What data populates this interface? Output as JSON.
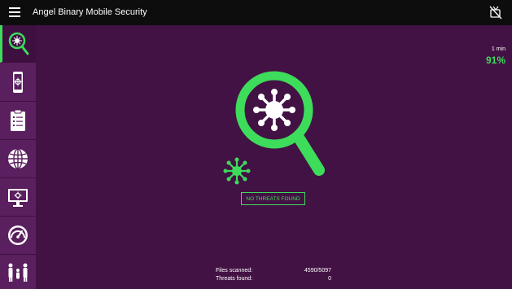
{
  "header": {
    "title": "Angel Binary Mobile Security"
  },
  "sidebar": {
    "items": [
      {
        "icon": "virus-scan-icon",
        "active": true
      },
      {
        "icon": "mobile-locate-icon",
        "active": false
      },
      {
        "icon": "clipboard-icon",
        "active": false
      },
      {
        "icon": "globe-icon",
        "active": false
      },
      {
        "icon": "monitor-settings-icon",
        "active": false
      },
      {
        "icon": "speedometer-icon",
        "active": false
      },
      {
        "icon": "family-icon",
        "active": false
      }
    ]
  },
  "scan": {
    "time": "1 min",
    "progress": "91%",
    "status": "NO THREATS FOUND",
    "files_scanned_label": "Files scanned:",
    "files_scanned_value": "4590/5097",
    "threats_found_label": "Threats found:",
    "threats_found_value": "0"
  },
  "colors": {
    "accent": "#3ddc5b",
    "background": "#431244",
    "sidebar": "#5a1f5e",
    "topbar": "#0d0d0d"
  }
}
